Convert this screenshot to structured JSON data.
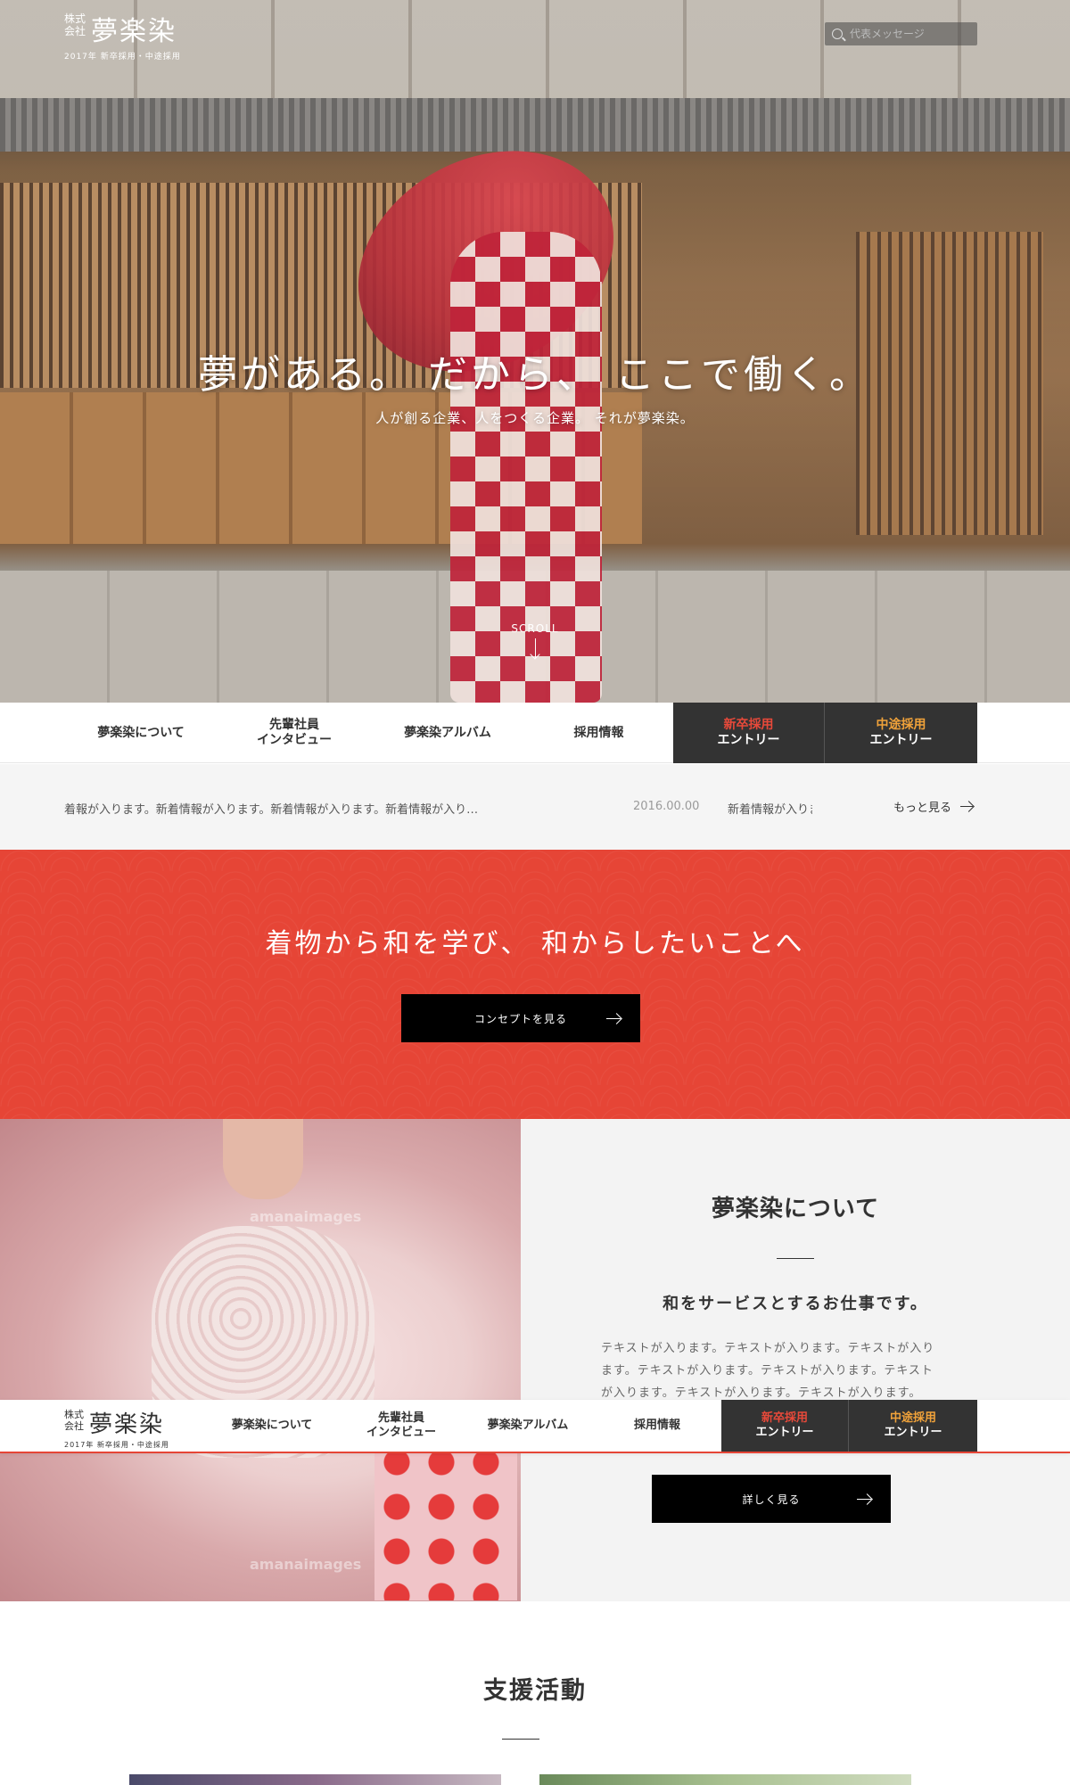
{
  "header": {
    "logo_kabushiki": "株式\n会社",
    "logo_name": "夢楽染",
    "logo_sub": "2017年 新卒採用・中途採用",
    "search_placeholder": "代表メッセージ"
  },
  "hero": {
    "headline": "夢がある。 だから、 ここで働く。",
    "tagline": "人が創る企業、人をつくる企業。 それが夢楽染。",
    "scroll_label": "SCROLL"
  },
  "nav": {
    "items": [
      {
        "label": "夢楽染について"
      },
      {
        "line1": "先輩社員",
        "line2": "インタビュー"
      },
      {
        "label": "夢楽染アルバム"
      },
      {
        "label": "採用情報"
      }
    ],
    "entry_new": {
      "line1": "新卒採用",
      "line2": "エントリー"
    },
    "entry_mid": {
      "line1": "中途採用",
      "line2": "エントリー"
    }
  },
  "news": {
    "text1": "着報が入ります。新着情報が入ります。新着情報が入ります。新着情報が入り…",
    "date": "2016.00.00",
    "text2": "新着情報が入ります。新着情報が入ります。",
    "more_label": "もっと見る"
  },
  "concept": {
    "heading": "着物から和を学び、 和からしたいことへ",
    "button_label": "コンセプトを見る"
  },
  "about": {
    "heading": "夢楽染について",
    "subheading": "和をサービスとするお仕事です。",
    "body": "テキストが入ります。テキストが入ります。テキストが入ります。テキストが入ります。テキストが入ります。テキストが入ります。テキストが入ります。テキストが入ります。",
    "button_label": "詳しく見る",
    "watermark": "amanaimages"
  },
  "support": {
    "heading": "支援活動"
  },
  "colors": {
    "accent_red": "#e64536",
    "entry_new": "#e8493a",
    "entry_mid": "#f0a23a",
    "entry_bg": "#333333"
  }
}
